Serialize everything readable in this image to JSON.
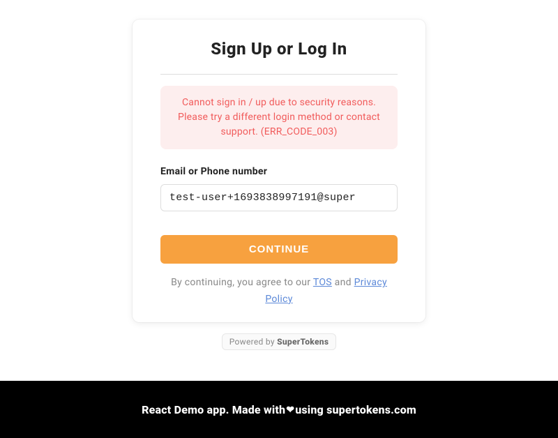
{
  "card": {
    "title": "Sign Up or Log In",
    "error": "Cannot sign in / up due to security reasons. Please try a different login method or contact support. (ERR_CODE_003)",
    "input_label": "Email or Phone number",
    "input_value": "test-user+1693838997191@super",
    "continue_label": "CONTINUE",
    "consent_prefix": "By continuing, you agree to our ",
    "tos_label": "TOS",
    "consent_middle": " and ",
    "privacy_label": "Privacy Policy",
    "powered_prefix": "Powered by ",
    "powered_brand": "SuperTokens"
  },
  "footer": {
    "text_prefix": "React Demo app. Made with",
    "heart": "❤",
    "text_suffix": "using supertokens.com"
  }
}
